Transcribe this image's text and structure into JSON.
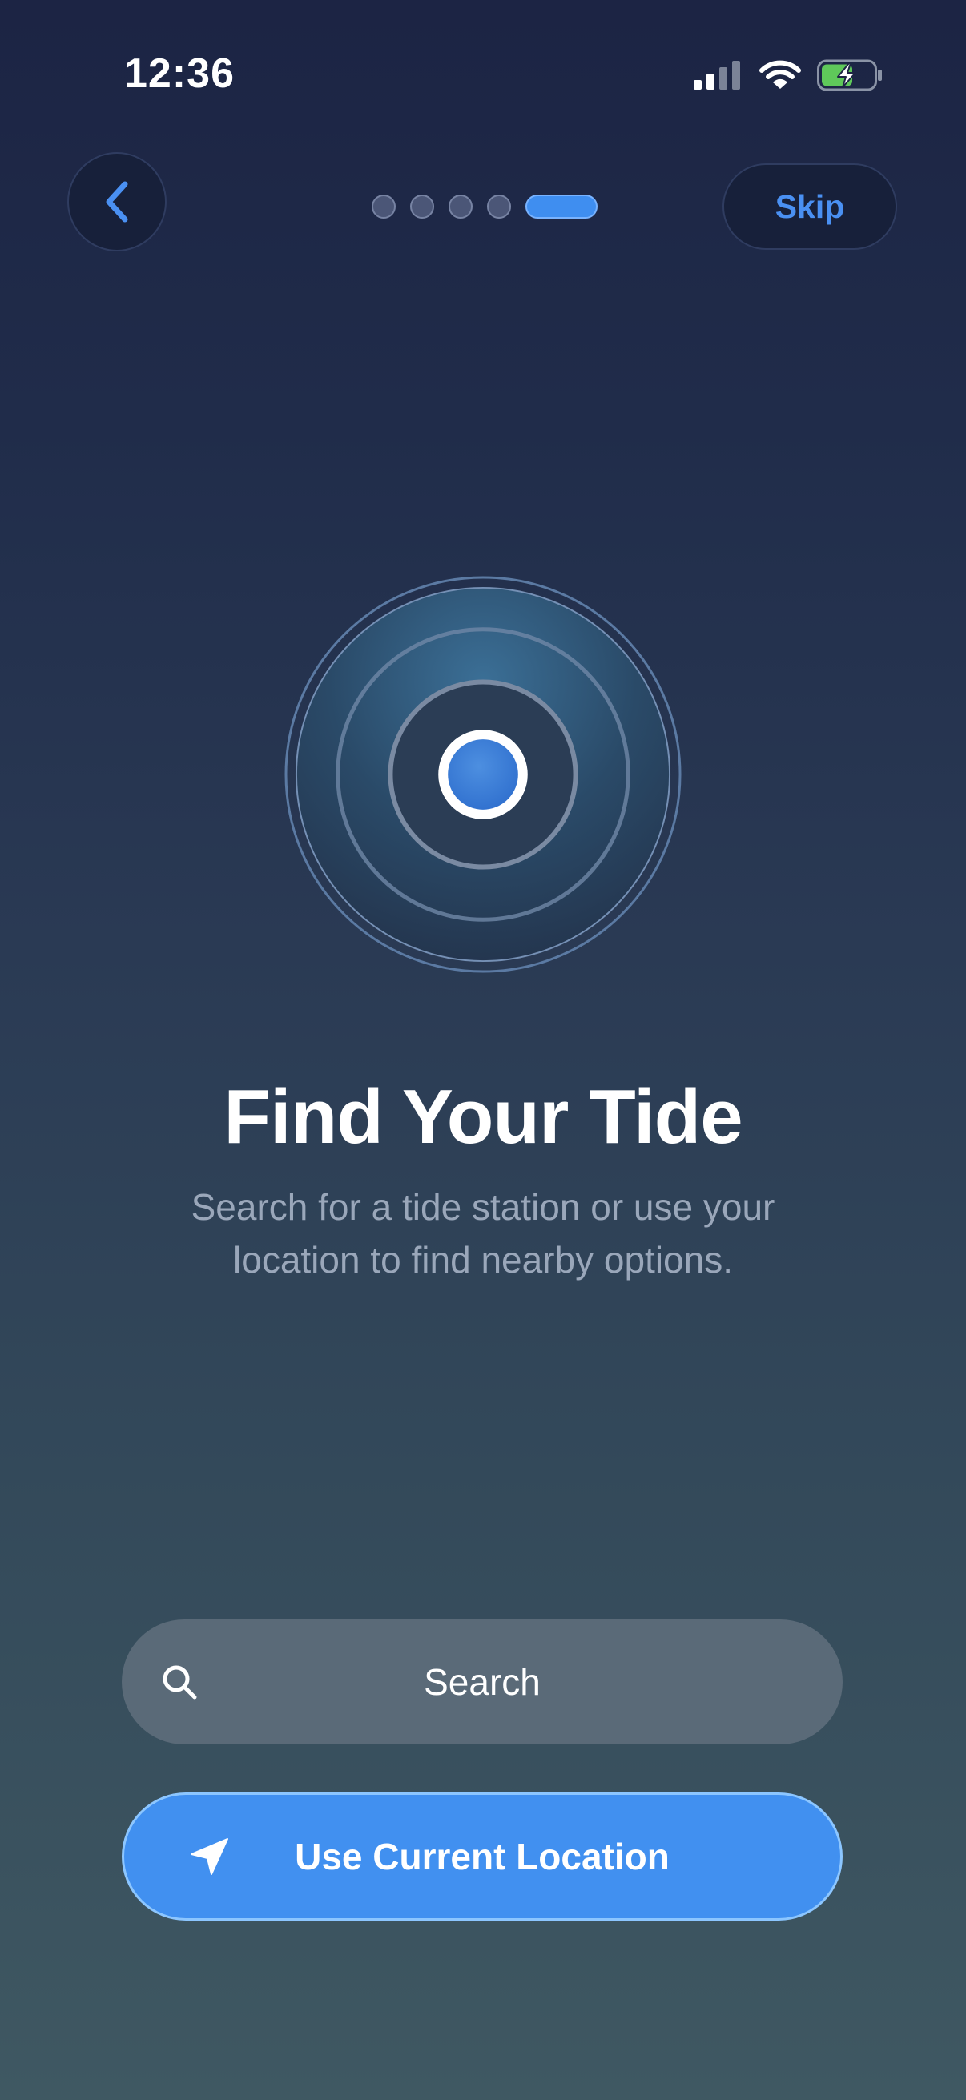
{
  "status_bar": {
    "time": "12:36",
    "icons": [
      "cellular-signal-icon",
      "wifi-icon",
      "battery-charging-icon"
    ]
  },
  "nav": {
    "back_icon": "chevron-left-icon",
    "skip_label": "Skip",
    "page_indicator": {
      "total": 5,
      "current": 5
    }
  },
  "hero": {
    "icon": "location-target-icon",
    "title": "Find Your Tide",
    "subtitle_line1": "Search for a tide station or use your",
    "subtitle_line2": "location to find nearby options."
  },
  "actions": {
    "search": {
      "label": "Search",
      "icon": "search-icon"
    },
    "use_location": {
      "label": "Use Current Location",
      "icon": "location-arrow-icon"
    }
  },
  "colors": {
    "accent": "#4190f0",
    "accent_text": "#4a90f2",
    "background_top": "#1c2444",
    "background_bottom": "#3f5862",
    "search_button_bg": "#5a6a78",
    "battery_charge": "#5fc85a"
  }
}
